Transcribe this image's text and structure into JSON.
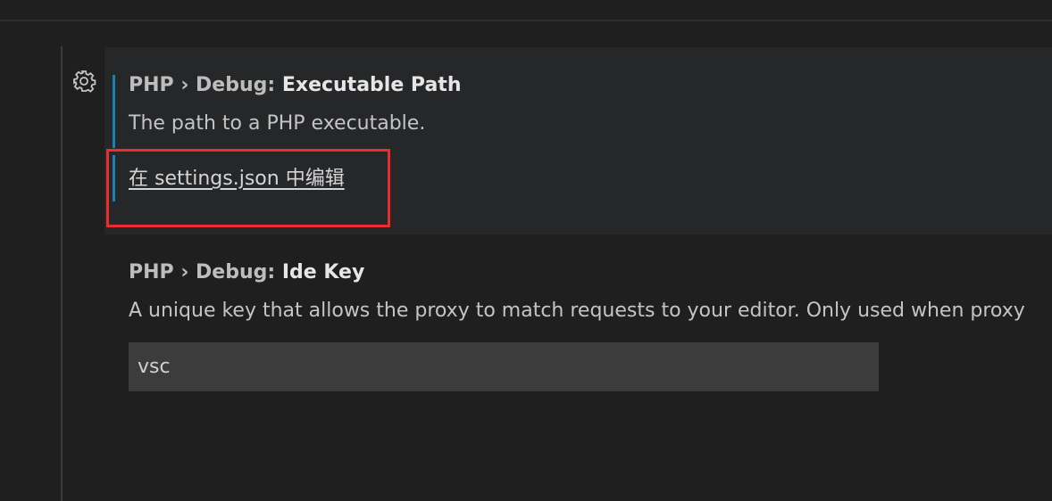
{
  "settings": [
    {
      "category": "PHP › Debug: ",
      "name": "Executable Path",
      "description": "The path to a PHP executable.",
      "edit_link": "在 settings.json 中编辑"
    },
    {
      "category": "PHP › Debug: ",
      "name": "Ide Key",
      "description": "A unique key that allows the proxy to match requests to your editor. Only used when proxy",
      "value": "vsc"
    }
  ],
  "icons": {
    "gear": "gear-icon"
  },
  "colors": {
    "modified_indicator": "#1b80b2",
    "highlight_border": "#ec2d30",
    "focused_background": "#262729"
  }
}
